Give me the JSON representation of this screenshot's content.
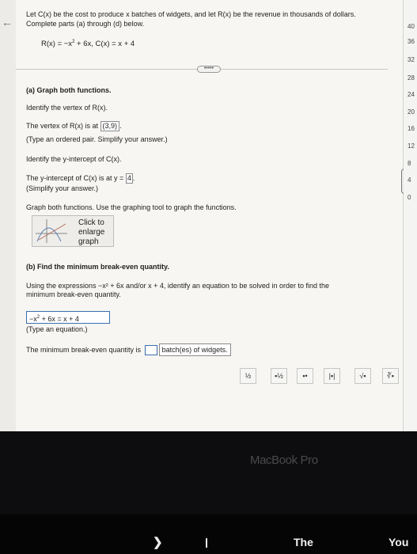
{
  "problem": {
    "intro": "Let C(x) be the cost to produce x batches of widgets, and let R(x) be the revenue in thousands of dollars. Complete parts (a) through (d) below.",
    "equation_r_left": "R(x) = −x",
    "equation_r_exp": "2",
    "equation_r_right": "+ 6x, C(x) = x + 4",
    "more_label": "•••••"
  },
  "part_a": {
    "heading": "(a) Graph both functions.",
    "vertex_prompt": "Identify the vertex of R(x).",
    "vertex_prefix": "The vertex of R(x) is at",
    "vertex_answer": "(3,9)",
    "vertex_suffix": ".",
    "vertex_hint": "(Type an ordered pair. Simplify your answer.)",
    "intercept_prompt": "Identify the y-intercept of C(x).",
    "intercept_prefix": "The y-intercept of C(x) is at y =",
    "intercept_answer": "4",
    "intercept_suffix": ".",
    "intercept_hint": "(Simplify your answer.)",
    "graph_instruction": "Graph both functions. Use the graphing tool to graph the functions.",
    "graph_tile_line1": "Click to",
    "graph_tile_line2": "enlarge",
    "graph_tile_line3": "graph"
  },
  "part_b": {
    "heading": "(b) Find the minimum break-even quantity.",
    "instruction_line1": "Using the expressions −x² + 6x and/or x + 4, identify an equation to be solved in order to find the",
    "instruction_line2": "minimum break-even quantity.",
    "equation_answer_left": "−x",
    "equation_answer_exp": "2",
    "equation_answer_right": "+ 6x = x + 4",
    "equation_hint": "(Type an equation.)",
    "minimum_prefix": "The minimum break-even quantity is",
    "minimum_answer": "",
    "minimum_suffix": "batch(es) of widgets."
  },
  "toolbar": {
    "buttons": [
      "½",
      "▪½",
      "▪•",
      "|▪|",
      "√▪",
      "∛▪"
    ],
    "icons": [
      "fraction-icon",
      "mixed-number-icon",
      "exponent-icon",
      "absolute-value-icon",
      "square-root-icon",
      "cube-root-icon"
    ]
  },
  "graph_axis": {
    "ticks": [
      "40",
      "36",
      "32",
      "28",
      "24",
      "20",
      "16",
      "12",
      "8",
      "4",
      "0"
    ]
  },
  "device": {
    "brand": "MacBook Pro",
    "key_chevron": "❯",
    "key_word_1": "The",
    "key_word_2": "You"
  }
}
